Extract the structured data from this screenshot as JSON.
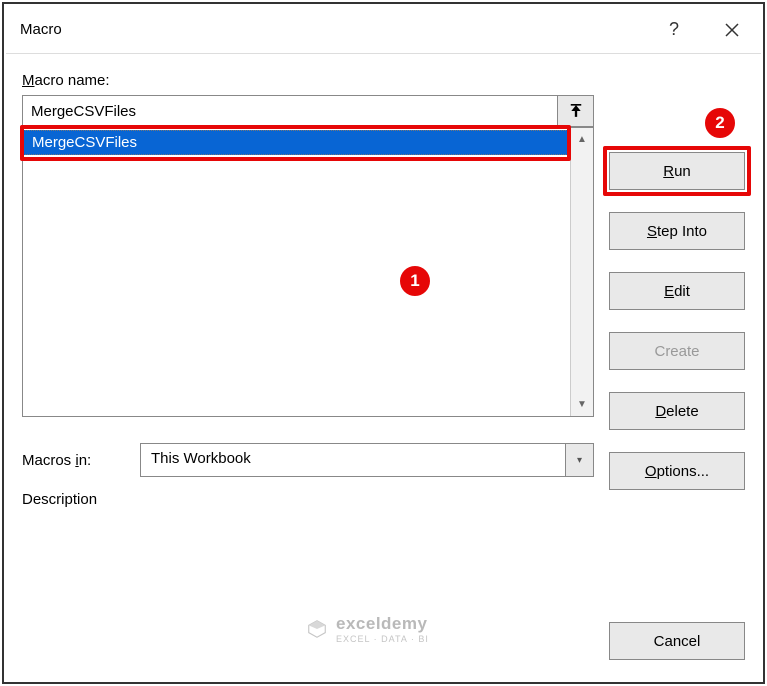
{
  "dialog": {
    "title": "Macro",
    "name_label_pre": "M",
    "name_label_post": "acro name:",
    "name_value": "MergeCSVFiles",
    "macros_in_label": "Macros ",
    "macros_in_underline": "i",
    "macros_in_post": "n:",
    "macros_in_value": "This Workbook",
    "description_label_pre": "D",
    "description_label_post": "escription"
  },
  "list": {
    "items": [
      "MergeCSVFiles"
    ]
  },
  "buttons": {
    "run_pre": "R",
    "run_post": "un",
    "step_pre": "S",
    "step_post": "tep Into",
    "edit_pre": "E",
    "edit_post": "dit",
    "create": "Create",
    "delete_pre": "D",
    "delete_post": "elete",
    "options_pre": "O",
    "options_post": "ptions...",
    "cancel": "Cancel"
  },
  "badges": {
    "one": "1",
    "two": "2"
  },
  "watermark": {
    "title": "exceldemy",
    "sub": "EXCEL · DATA · BI"
  }
}
